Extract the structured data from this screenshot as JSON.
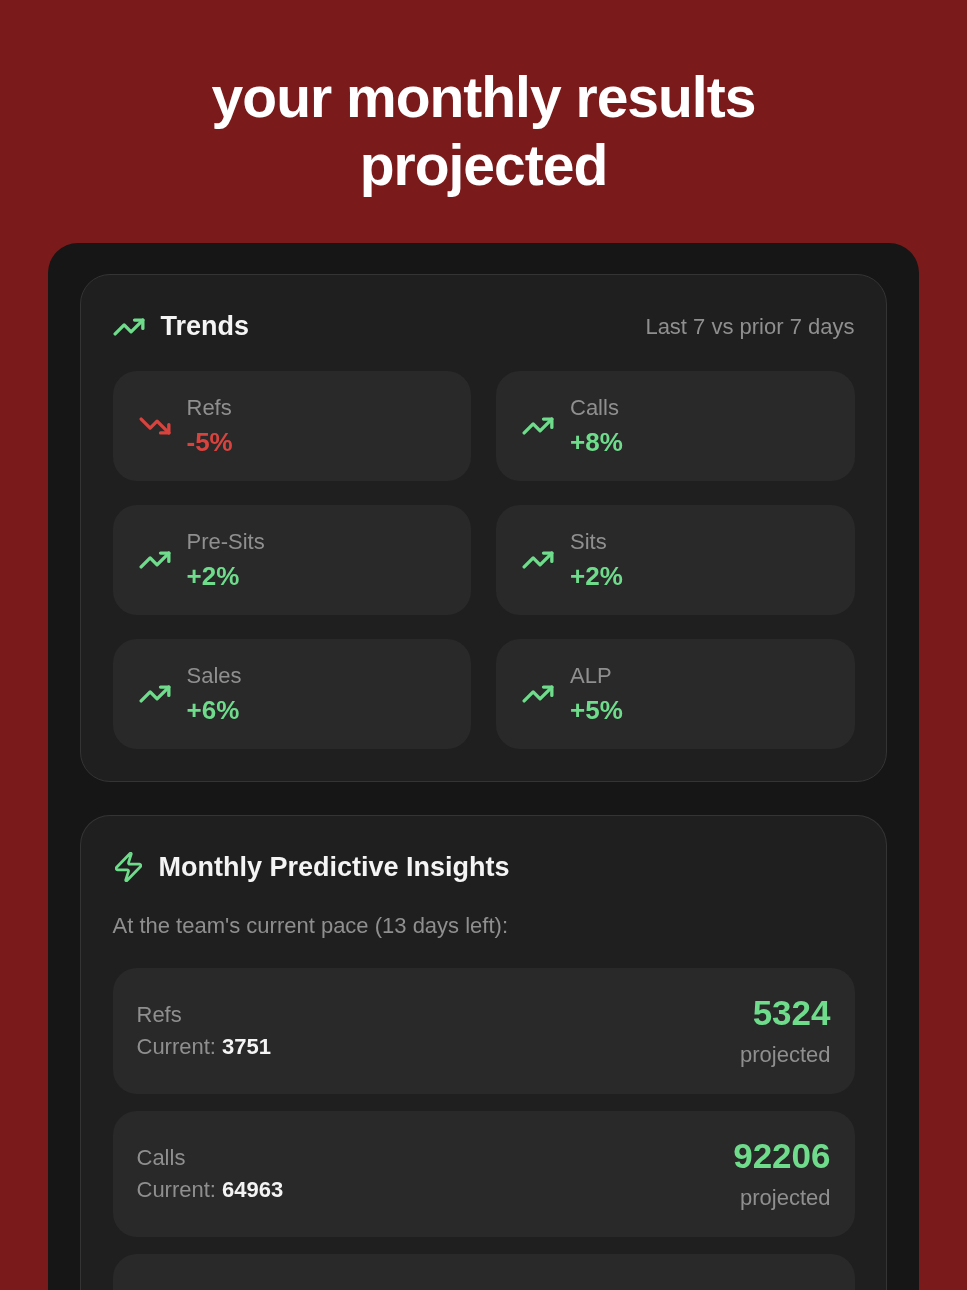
{
  "headline": "your monthly results projected",
  "trends": {
    "title": "Trends",
    "period": "Last 7 vs prior 7 days",
    "items": [
      {
        "kind": "down",
        "label": "Refs",
        "change": "-5%"
      },
      {
        "kind": "up",
        "label": "Calls",
        "change": "+8%"
      },
      {
        "kind": "up",
        "label": "Pre-Sits",
        "change": "+2%"
      },
      {
        "kind": "up",
        "label": "Sits",
        "change": "+2%"
      },
      {
        "kind": "up",
        "label": "Sales",
        "change": "+6%"
      },
      {
        "kind": "up",
        "label": "ALP",
        "change": "+5%"
      }
    ]
  },
  "insights": {
    "title": "Monthly Predictive Insights",
    "subtitle": "At the team's current pace (13 days left):",
    "rows": [
      {
        "kind": "stat",
        "label": "Refs",
        "current": "Current: **3751**",
        "projected": "5324",
        "projected_label": "projected"
      },
      {
        "kind": "stat",
        "label": "Calls",
        "current": "Current: **64963**",
        "projected": "92206",
        "projected_label": "projected"
      },
      {
        "kind": "clipped"
      }
    ]
  }
}
